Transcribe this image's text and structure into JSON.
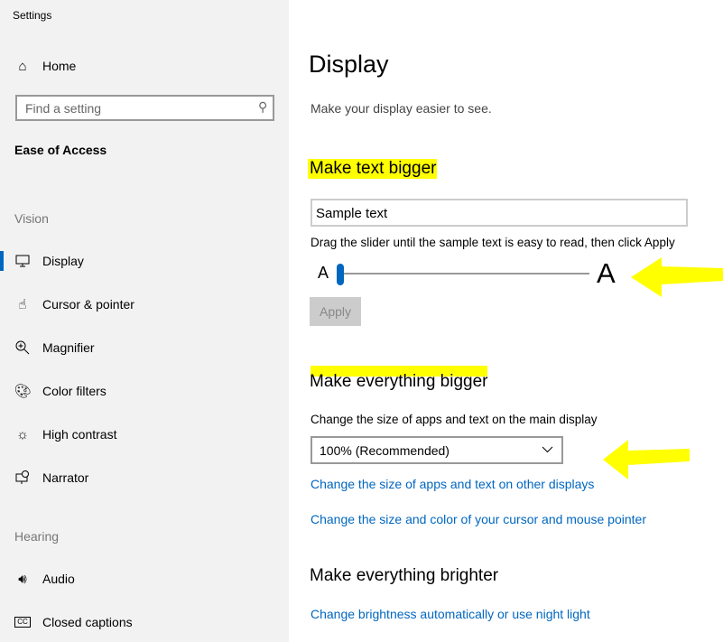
{
  "window": {
    "title": "Settings"
  },
  "sidebar": {
    "home": "Home",
    "search_placeholder": "Find a setting",
    "category": "Ease of Access",
    "sections": [
      {
        "title": "Vision",
        "items": [
          {
            "label": "Display",
            "icon": "monitor-icon",
            "selected": true
          },
          {
            "label": "Cursor & pointer",
            "icon": "cursor-pointer-icon"
          },
          {
            "label": "Magnifier",
            "icon": "magnifier-icon"
          },
          {
            "label": "Color filters",
            "icon": "palette-icon"
          },
          {
            "label": "High contrast",
            "icon": "sun-icon"
          },
          {
            "label": "Narrator",
            "icon": "narrator-icon"
          }
        ]
      },
      {
        "title": "Hearing",
        "items": [
          {
            "label": "Audio",
            "icon": "speaker-icon"
          },
          {
            "label": "Closed captions",
            "icon": "closed-captions-icon"
          }
        ]
      }
    ]
  },
  "main": {
    "title": "Display",
    "subtitle": "Make your display easier to see.",
    "text_bigger": {
      "heading": "Make text bigger",
      "sample": "Sample text",
      "instruction": "Drag the slider until the sample text is easy to read, then click Apply",
      "small_a": "A",
      "large_a": "A",
      "slider_value_percent": 0,
      "apply": "Apply"
    },
    "everything_bigger": {
      "heading": "Make everything bigger",
      "label": "Change the size of apps and text on the main display",
      "dropdown_value": "100% (Recommended)",
      "link1": "Change the size of apps and text on other displays",
      "link2": "Change the size and color of your cursor and mouse pointer"
    },
    "brighter": {
      "heading": "Make everything brighter",
      "link": "Change brightness automatically or use night light"
    }
  },
  "colors": {
    "accent": "#0067c0",
    "annotation": "#ffff00",
    "sidebar_bg": "#f2f2f2"
  }
}
